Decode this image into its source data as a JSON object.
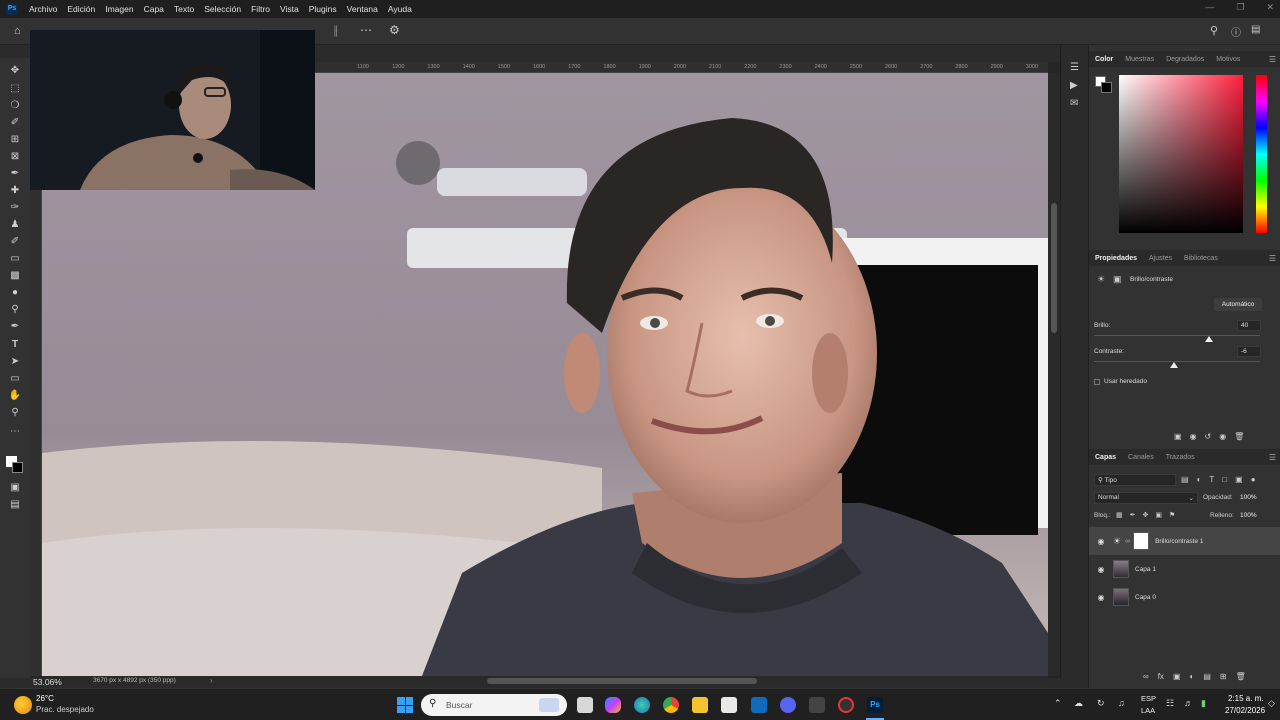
{
  "app": {
    "logo": "Ps"
  },
  "menu": [
    "Archivo",
    "Edición",
    "Imagen",
    "Capa",
    "Texto",
    "Selección",
    "Filtro",
    "Vista",
    "Plugins",
    "Ventana",
    "Ayuda"
  ],
  "ruler": {
    "ticks": [
      "1100",
      "1200",
      "1300",
      "1400",
      "1500",
      "1600",
      "1700",
      "1800",
      "1900",
      "2000",
      "2100",
      "2200",
      "2300",
      "2400",
      "2500",
      "2600",
      "2700",
      "2800",
      "2900",
      "3000"
    ]
  },
  "status": {
    "zoom": "53.06%",
    "doc_info": "3670 px x 4892 px (350 ppp)"
  },
  "color_panel": {
    "tabs": [
      "Color",
      "Muestras",
      "Degradados",
      "Motivos"
    ],
    "active": "Color",
    "fg_color": "#ffffff",
    "bg_color": "#000000",
    "hue_color": "#ff1f3d"
  },
  "properties": {
    "tabs": [
      "Propiedades",
      "Ajustes",
      "Bibliotecas"
    ],
    "active": "Propiedades",
    "adjustment": "Brillo/contraste",
    "auto_button": "Automático",
    "brightness_label": "Brillo:",
    "brightness_value": "40",
    "brightness_level": 0.69,
    "contrast_label": "Contraste:",
    "contrast_value": "-6",
    "contrast_level": 0.48,
    "legacy_label": "Usar heredado"
  },
  "layers": {
    "tabs": [
      "Capas",
      "Canales",
      "Trazados"
    ],
    "active": "Capas",
    "filter": "Tipo",
    "blend_mode": "Normal",
    "opacity_label": "Opacidad:",
    "opacity": "100%",
    "lock_label": "Bloq.:",
    "fill_label": "Relleno:",
    "fill": "100%",
    "items": [
      {
        "name": "Brillo/contraste 1",
        "selected": true
      },
      {
        "name": "Capa 1",
        "selected": false
      },
      {
        "name": "Capa 0",
        "selected": false
      }
    ]
  },
  "taskbar": {
    "weather_temp": "26°C",
    "weather_desc": "Prac. despejado",
    "search_placeholder": "Buscar",
    "lang": "ESP",
    "lang_sub": "LAA",
    "time": "2:15 a. m.",
    "date": "27/02/2026",
    "ps_label": "Ps"
  }
}
